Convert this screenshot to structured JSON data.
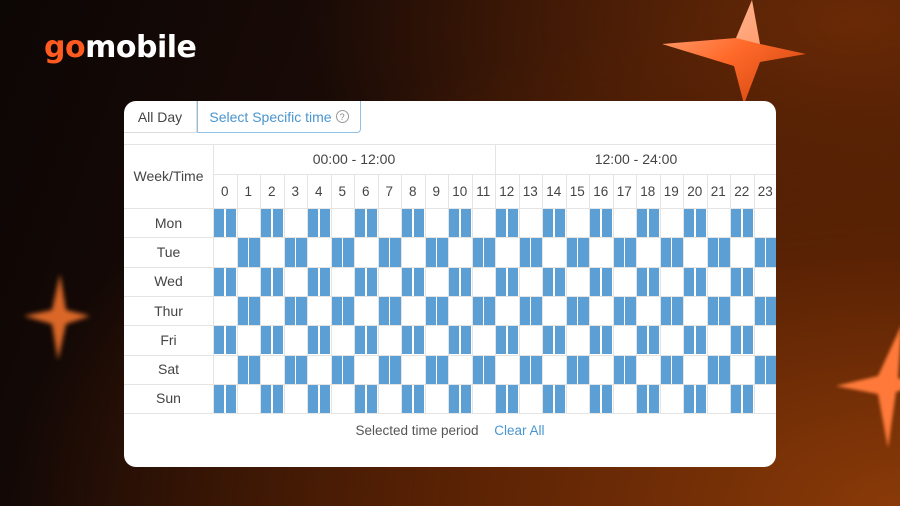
{
  "brand": {
    "go": "go",
    "mobile": "mobile"
  },
  "tabs": {
    "all_day": "All Day",
    "specific": "Select Specific time",
    "help_glyph": "?"
  },
  "table": {
    "corner": "Week/Time",
    "periods": [
      "00:00 - 12:00",
      "12:00 - 24:00"
    ],
    "hours": [
      "0",
      "1",
      "2",
      "3",
      "4",
      "5",
      "6",
      "7",
      "8",
      "9",
      "10",
      "11",
      "12",
      "13",
      "14",
      "15",
      "16",
      "17",
      "18",
      "19",
      "20",
      "21",
      "22",
      "23"
    ],
    "days": [
      "Mon",
      "Tue",
      "Wed",
      "Thur",
      "Fri",
      "Sat",
      "Sun"
    ],
    "selected_color": "#5b9fd4",
    "selected_halfhour_pattern": [
      "110011001100110011001100110011001100110011001100",
      "001100110011001100110011001100110011001100110011",
      "110011001100110011001100110011001100110011001100",
      "001100110011001100110011001100110011001100110011",
      "110011001100110011001100110011001100110011001100",
      "001100110011001100110011001100110011001100110011",
      "110011001100110011001100110011001100110011001100"
    ]
  },
  "footer": {
    "label": "Selected time period",
    "clear": "Clear All"
  }
}
